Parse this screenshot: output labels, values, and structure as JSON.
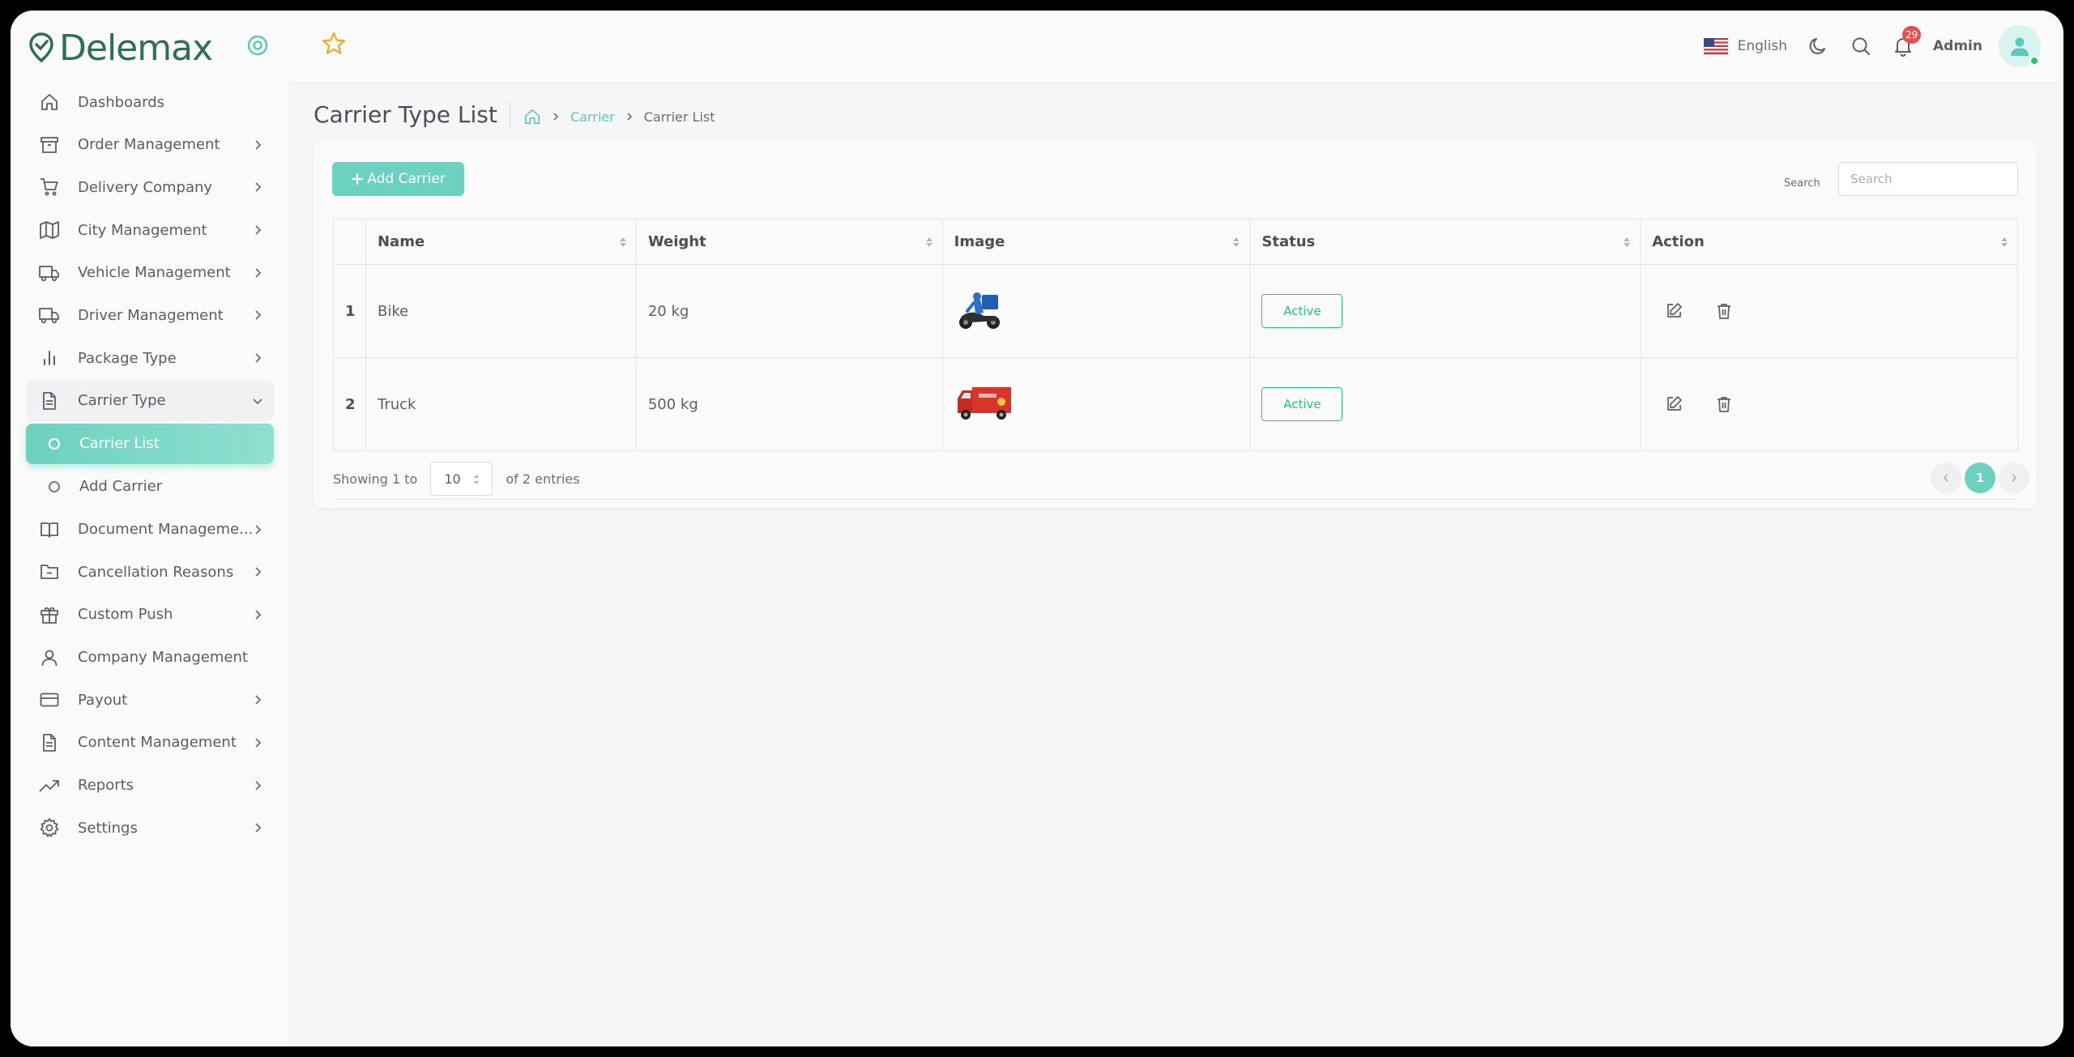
{
  "brand": {
    "name": "Delemax"
  },
  "header": {
    "language": "English",
    "notification_count": "29",
    "user_name": "Admin"
  },
  "sidebar": {
    "items": [
      {
        "label": "Dashboards",
        "icon": "home-icon",
        "chevron": false
      },
      {
        "label": "Order Management",
        "icon": "archive-icon",
        "chevron": true
      },
      {
        "label": "Delivery Company",
        "icon": "cart-icon",
        "chevron": true
      },
      {
        "label": "City Management",
        "icon": "map-icon",
        "chevron": true
      },
      {
        "label": "Vehicle Management",
        "icon": "truck-icon",
        "chevron": true
      },
      {
        "label": "Driver Management",
        "icon": "truck-icon",
        "chevron": true
      },
      {
        "label": "Package Type",
        "icon": "bar-chart-icon",
        "chevron": true
      },
      {
        "label": "Carrier Type",
        "icon": "file-icon",
        "chevron": true,
        "open": true
      },
      {
        "label": "Document Manageme...",
        "icon": "book-icon",
        "chevron": true
      },
      {
        "label": "Cancellation Reasons",
        "icon": "folder-minus-icon",
        "chevron": true
      },
      {
        "label": "Custom Push",
        "icon": "gift-icon",
        "chevron": true
      },
      {
        "label": "Company Management",
        "icon": "user-icon",
        "chevron": false
      },
      {
        "label": "Payout",
        "icon": "credit-card-icon",
        "chevron": true
      },
      {
        "label": "Content Management",
        "icon": "file-text-icon",
        "chevron": true
      },
      {
        "label": "Reports",
        "icon": "trending-up-icon",
        "chevron": true
      },
      {
        "label": "Settings",
        "icon": "settings-icon",
        "chevron": true
      }
    ],
    "submenu": [
      {
        "label": "Carrier List",
        "active": true
      },
      {
        "label": "Add Carrier",
        "active": false
      }
    ]
  },
  "page": {
    "title": "Carrier Type List",
    "breadcrumb": {
      "parent": "Carrier",
      "current": "Carrier List"
    }
  },
  "toolbar": {
    "add_label": "Add Carrier",
    "search_label": "Search",
    "search_placeholder": "Search"
  },
  "table": {
    "columns": [
      "Name",
      "Weight",
      "Image",
      "Status",
      "Action"
    ],
    "rows": [
      {
        "num": "1",
        "name": "Bike",
        "weight": "20 kg",
        "image": "motorbike-courier-image",
        "status": "Active"
      },
      {
        "num": "2",
        "name": "Truck",
        "weight": "500 kg",
        "image": "delivery-truck-image",
        "status": "Active"
      }
    ]
  },
  "footer": {
    "showing_prefix": "Showing 1 to",
    "page_length": "10",
    "showing_suffix": "of 2 entries",
    "current_page": "1"
  },
  "colors": {
    "accent": "#6cd1bf",
    "brand": "#2f6d5c",
    "active_status": "#28c76f",
    "badge": "#e05353",
    "star": "#f5a623"
  }
}
